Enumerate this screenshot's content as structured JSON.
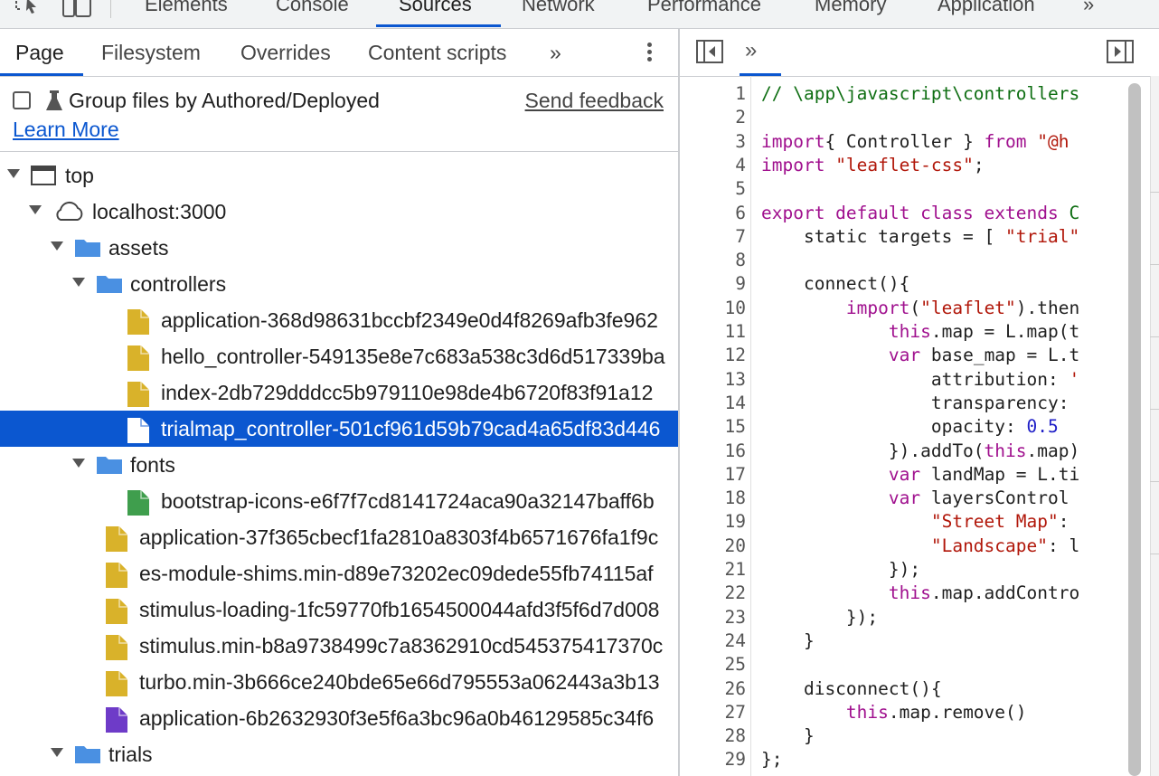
{
  "top_tabs": [
    "Elements",
    "Console",
    "Sources",
    "Network",
    "Performance",
    "Memory",
    "Application"
  ],
  "top_more": "»",
  "sub_tabs": [
    "Page",
    "Filesystem",
    "Overrides",
    "Content scripts"
  ],
  "sub_more": "»",
  "group_label": "Group files by Authored/Deployed",
  "send_feedback": "Send feedback",
  "learn_more": "Learn More",
  "tree": [
    {
      "label": "top",
      "type": "frame",
      "depth": 0,
      "expanded": true
    },
    {
      "label": "localhost:3000",
      "type": "cloud",
      "depth": 1,
      "expanded": true
    },
    {
      "label": "assets",
      "type": "folder",
      "depth": 2,
      "expanded": true
    },
    {
      "label": "controllers",
      "type": "folder",
      "depth": 3,
      "expanded": true
    },
    {
      "label": "application-368d98631bccbf2349e0d4f8269afb3fe962",
      "type": "js",
      "depth": 4
    },
    {
      "label": "hello_controller-549135e8e7c683a538c3d6d517339ba",
      "type": "js",
      "depth": 4
    },
    {
      "label": "index-2db729dddcc5b979110e98de4b6720f83f91a12",
      "type": "js",
      "depth": 4
    },
    {
      "label": "trialmap_controller-501cf961d59b79cad4a65df83d446",
      "type": "js",
      "depth": 4,
      "selected": true
    },
    {
      "label": "fonts",
      "type": "folder",
      "depth": 3,
      "expanded": true
    },
    {
      "label": "bootstrap-icons-e6f7f7cd8141724aca90a32147baff6b",
      "type": "font",
      "depth": 4
    },
    {
      "label": "application-37f365cbecf1fa2810a8303f4b6571676fa1f9c",
      "type": "js",
      "depth": 3
    },
    {
      "label": "es-module-shims.min-d89e73202ec09dede55fb74115af",
      "type": "js",
      "depth": 3
    },
    {
      "label": "stimulus-loading-1fc59770fb1654500044afd3f5f6d7d008",
      "type": "js",
      "depth": 3
    },
    {
      "label": "stimulus.min-b8a9738499c7a8362910cd545375417370c",
      "type": "js",
      "depth": 3
    },
    {
      "label": "turbo.min-3b666ce240bde65e66d795553a062443a3b13",
      "type": "js",
      "depth": 3
    },
    {
      "label": "application-6b2632930f3e5f6a3bc96a0b46129585c34f6",
      "type": "css",
      "depth": 3
    },
    {
      "label": "trials",
      "type": "folder",
      "depth": 2,
      "expanded": true
    }
  ],
  "colors": {
    "accent": "#0b57d0",
    "js_file": "#d9b22a",
    "font_file": "#3f9e4d",
    "css_file": "#6e3bc8",
    "folder": "#4a90e2"
  },
  "code_lines": [
    [
      [
        "cm",
        "// \\app\\javascript\\controllers"
      ]
    ],
    [],
    [
      [
        "kw",
        "import"
      ],
      [
        "",
        "{ Controller } "
      ],
      [
        "kw",
        "from"
      ],
      [
        "str",
        " \"@h"
      ]
    ],
    [
      [
        "kw",
        "import"
      ],
      [
        "str",
        " \"leaflet-css\""
      ],
      [
        "",
        ";"
      ]
    ],
    [],
    [
      [
        "kw",
        "export default class extends"
      ],
      [
        "cm",
        " C"
      ]
    ],
    [
      [
        "",
        "    static targets = [ "
      ],
      [
        "str",
        "\"trial\""
      ]
    ],
    [],
    [
      [
        "",
        "    connect(){"
      ]
    ],
    [
      [
        "",
        "        "
      ],
      [
        "kw",
        "import"
      ],
      [
        "",
        "("
      ],
      [
        "str",
        "\"leaflet\""
      ],
      [
        "",
        ").then"
      ]
    ],
    [
      [
        "",
        "            "
      ],
      [
        "kw",
        "this"
      ],
      [
        "",
        ".map = L.map(t"
      ]
    ],
    [
      [
        "",
        "            "
      ],
      [
        "kw",
        "var"
      ],
      [
        "",
        " base_map = L.t"
      ]
    ],
    [
      [
        "",
        "                attribution: "
      ],
      [
        "str",
        "'"
      ]
    ],
    [
      [
        "",
        "                transparency:"
      ]
    ],
    [
      [
        "",
        "                opacity: "
      ],
      [
        "num",
        "0.5"
      ]
    ],
    [
      [
        "",
        "            }).addTo("
      ],
      [
        "kw",
        "this"
      ],
      [
        "",
        ".map)"
      ]
    ],
    [
      [
        "",
        "            "
      ],
      [
        "kw",
        "var"
      ],
      [
        "",
        " landMap = L.ti"
      ]
    ],
    [
      [
        "",
        "            "
      ],
      [
        "kw",
        "var"
      ],
      [
        "",
        " layersControl"
      ]
    ],
    [
      [
        "",
        "                "
      ],
      [
        "str",
        "\"Street Map\""
      ],
      [
        "",
        ":"
      ]
    ],
    [
      [
        "",
        "                "
      ],
      [
        "str",
        "\"Landscape\""
      ],
      [
        "",
        ": l"
      ]
    ],
    [
      [
        "",
        "            });"
      ]
    ],
    [
      [
        "",
        "            "
      ],
      [
        "kw",
        "this"
      ],
      [
        "",
        ".map.addContro"
      ]
    ],
    [
      [
        "",
        "        });"
      ]
    ],
    [
      [
        "",
        "    }"
      ]
    ],
    [],
    [
      [
        "",
        "    disconnect(){"
      ]
    ],
    [
      [
        "",
        "        "
      ],
      [
        "kw",
        "this"
      ],
      [
        "",
        ".map.remove()"
      ]
    ],
    [
      [
        "",
        "    }"
      ]
    ],
    [
      [
        "",
        "};"
      ]
    ]
  ]
}
